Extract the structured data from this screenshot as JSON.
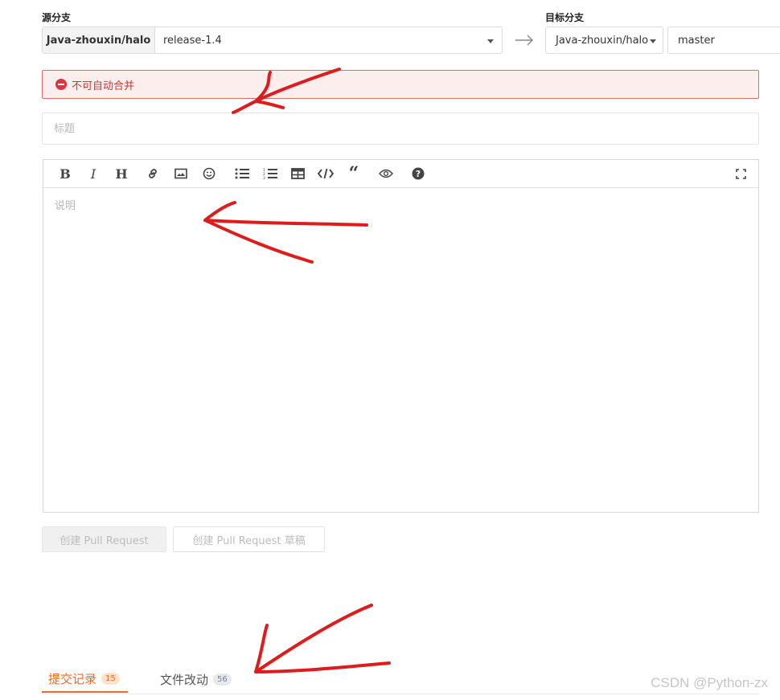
{
  "source": {
    "label": "源分支",
    "repo": "Java-zhouxin/halo",
    "branch": "release-1.4"
  },
  "target": {
    "label": "目标分支",
    "repo": "Java-zhouxin/halo",
    "branch": "master"
  },
  "alert": {
    "text": "不可自动合并",
    "icon": "minus-circle-icon",
    "color": "#d9363e"
  },
  "title_input": {
    "placeholder": "标题",
    "value": ""
  },
  "editor": {
    "placeholder": "说明",
    "toolbar": [
      "bold-icon",
      "italic-icon",
      "heading-icon",
      "link-icon",
      "image-icon",
      "emoji-icon",
      "bullet-list-icon",
      "numbered-list-icon",
      "table-icon",
      "code-icon",
      "quote-icon",
      "preview-icon",
      "help-icon",
      "fullscreen-icon"
    ]
  },
  "buttons": {
    "create": "创建 Pull Request",
    "draft": "创建 Pull Request 草稿"
  },
  "tabs": [
    {
      "label": "提交记录",
      "count": "15",
      "active": true
    },
    {
      "label": "文件改动",
      "count": "56",
      "active": false
    }
  ],
  "colors": {
    "accent": "#ef6b22",
    "annotation": "#e01b1b"
  },
  "watermark": "CSDN @Python-zx"
}
